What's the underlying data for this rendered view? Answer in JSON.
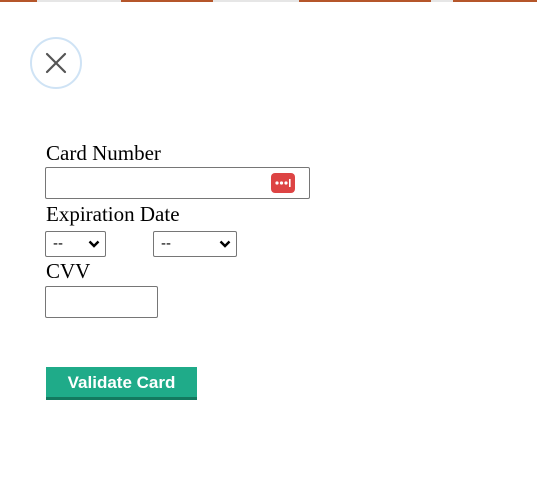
{
  "colors": {
    "accent_button": "#1fab89",
    "close_ring": "#cfe3f5",
    "password_key_badge": "#dd4444",
    "top_strip": [
      "#b5562a",
      "#e0e0e0",
      "#b5562a",
      "#e0e0e0",
      "#b5562a",
      "#e0e0e0",
      "#b5562a"
    ]
  },
  "icons": {
    "close": "close-icon",
    "password_manager": "password-key-icon",
    "dropdown": "chevron-down-icon"
  },
  "form": {
    "card_number": {
      "label": "Card Number",
      "value": ""
    },
    "expiration": {
      "label": "Expiration Date",
      "month_selected": "--",
      "year_selected": "--"
    },
    "cvv": {
      "label": "CVV",
      "value": ""
    },
    "submit_label": "Validate Card"
  }
}
